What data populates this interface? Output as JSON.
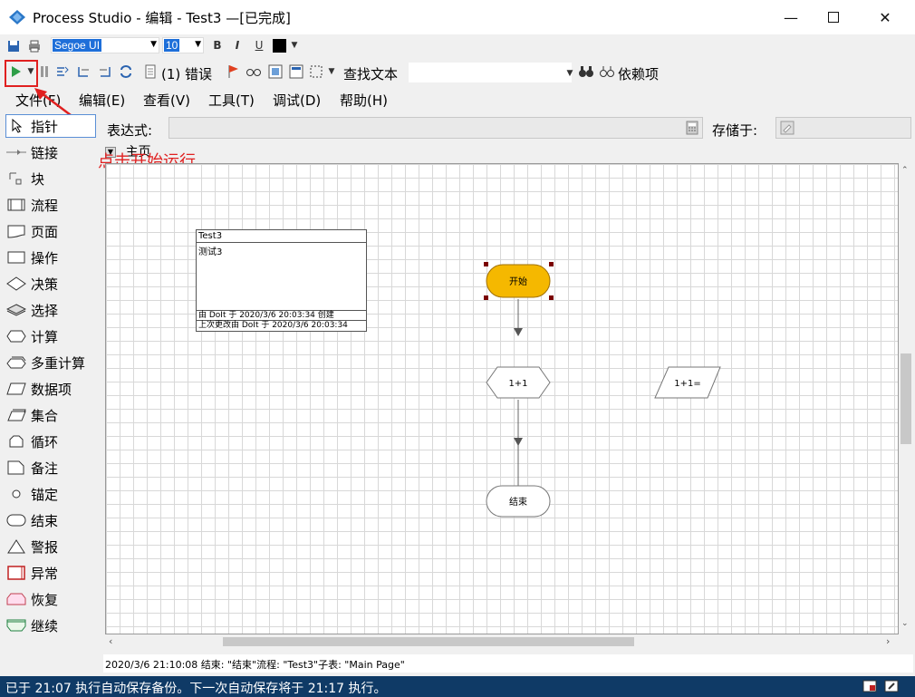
{
  "window": {
    "title": "Process Studio  - 编辑 - Test3 —[已完成]",
    "minimize_icon": "minimize-icon",
    "maximize_icon": "maximize-icon",
    "close_icon": "close-icon"
  },
  "format_bar": {
    "font": "Segoe UI",
    "font_size": "10",
    "bold": "B",
    "italic": "I",
    "underline": "U"
  },
  "toolbar": {
    "errors_label": "(1) 错误",
    "find_label": "查找文本",
    "dependency_label": "依赖项"
  },
  "menu": [
    "文件(F)",
    "编辑(E)",
    "查看(V)",
    "工具(T)",
    "调试(D)",
    "帮助(H)"
  ],
  "palette": [
    "指针",
    "链接",
    "块",
    "流程",
    "页面",
    "操作",
    "决策",
    "选择",
    "计算",
    "多重计算",
    "数据项",
    "集合",
    "循环",
    "备注",
    "锚定",
    "结束",
    "警报",
    "异常",
    "恢复",
    "继续"
  ],
  "expression": {
    "label": "表达式:",
    "store_label": "存储于:"
  },
  "page_tab": "主页",
  "annotation": "点击开始运行",
  "info_box": {
    "title": "Test3",
    "description": "测试3",
    "created": "由 DoIt 于 2020/3/6  20:03:34  创建",
    "modified": "上次更改由 DoIt 于 2020/3/6 20:03:34"
  },
  "flow": {
    "start": "开始",
    "calc": "1+1",
    "data": "1+1=",
    "end": "结束"
  },
  "log_line": "2020/3/6 21:10:08 结束:   \"结束\"流程:   \"Test3\"子表:   \"Main Page\"",
  "status_bar": "已于 21:07 执行自动保存备份。下一次自动保存将于 21:17 执行。",
  "colors": {
    "start_fill": "#f5b800",
    "annotation": "#e02020",
    "status_bg": "#0f3a66"
  }
}
